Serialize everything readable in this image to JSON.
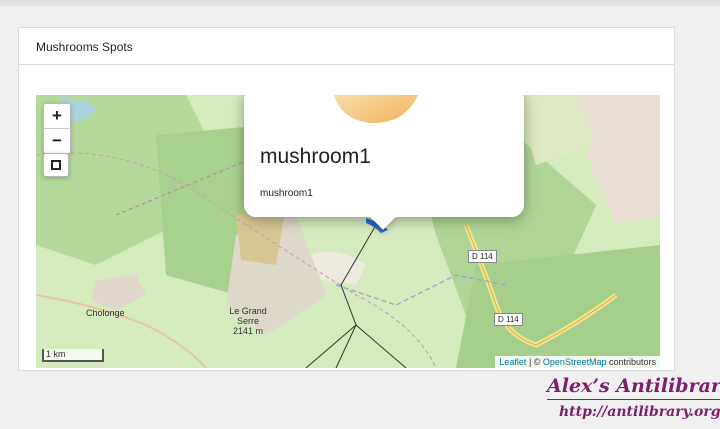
{
  "panel": {
    "title": "Mushrooms Spots"
  },
  "map": {
    "zoom_in_label": "+",
    "zoom_out_label": "−",
    "scale_label": "1 km",
    "attribution": {
      "leaflet": "Leaflet",
      "separator": " | © ",
      "osm": "OpenStreetMap",
      "suffix": " contributors"
    },
    "places": [
      {
        "name": "Cholonge"
      },
      {
        "name": "Le Grand Serre",
        "line2": "2141 m"
      }
    ],
    "roads": [
      "D 114",
      "D 114"
    ]
  },
  "popup": {
    "title": "mushroom1",
    "text": "mushroom1"
  },
  "watermark": {
    "title": "Alex’s Antilibrary",
    "url": "http://antilibrary.org"
  },
  "colors": {
    "map_green": "#cfe7b0",
    "forest": "#a9d18e",
    "marker": "#2a6fd6",
    "watermark": "#7b1f6e"
  }
}
